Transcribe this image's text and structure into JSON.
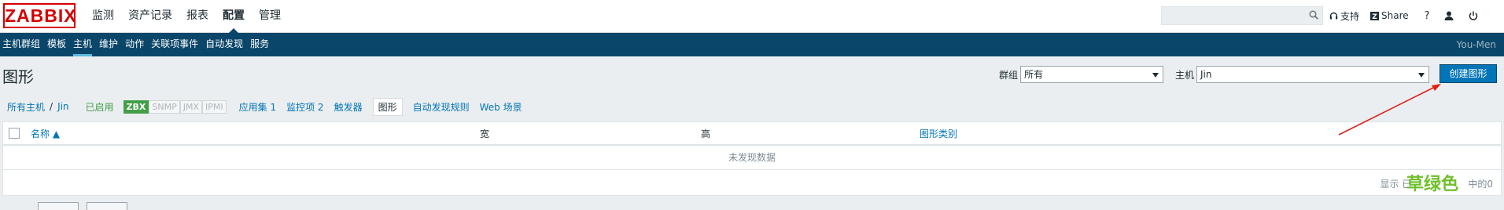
{
  "header": {
    "logo": "ZABBIX",
    "main_menu": [
      "监测",
      "资产记录",
      "报表",
      "配置",
      "管理"
    ],
    "active_main": 3,
    "support": "支持",
    "share": "Share",
    "help": "?"
  },
  "subnav": {
    "items": [
      "主机群组",
      "模板",
      "主机",
      "维护",
      "动作",
      "关联项事件",
      "自动发现",
      "服务"
    ],
    "active": 2,
    "user": "You-Men"
  },
  "page": {
    "title": "图形",
    "group_label": "群组",
    "group_value": "所有",
    "host_label": "主机",
    "host_value": "Jin",
    "create_button": "创建图形"
  },
  "breadcrumb": {
    "all_hosts": "所有主机",
    "separator": "/",
    "host": "Jin",
    "status": "已启用",
    "tags": [
      "ZBX",
      "SNMP",
      "JMX",
      "IPMI"
    ],
    "tabs": [
      "应用集 1",
      "监控项 2",
      "触发器",
      "图形",
      "自动发现规则",
      "Web 场景"
    ],
    "selected_tab": 3
  },
  "table": {
    "columns": [
      "名称 ▲",
      "宽",
      "高",
      "图形类别"
    ],
    "empty_text": "未发现数据",
    "footer_text": "显示 已",
    "footer_suffix": "中的0",
    "watermark": "草绿色"
  },
  "colors": {
    "brand_red": "#d40000",
    "nav_blue": "#0a466a",
    "link_blue": "#0275b8",
    "enabled_green": "#429e47",
    "annotation_arrow": "#e0201a"
  }
}
